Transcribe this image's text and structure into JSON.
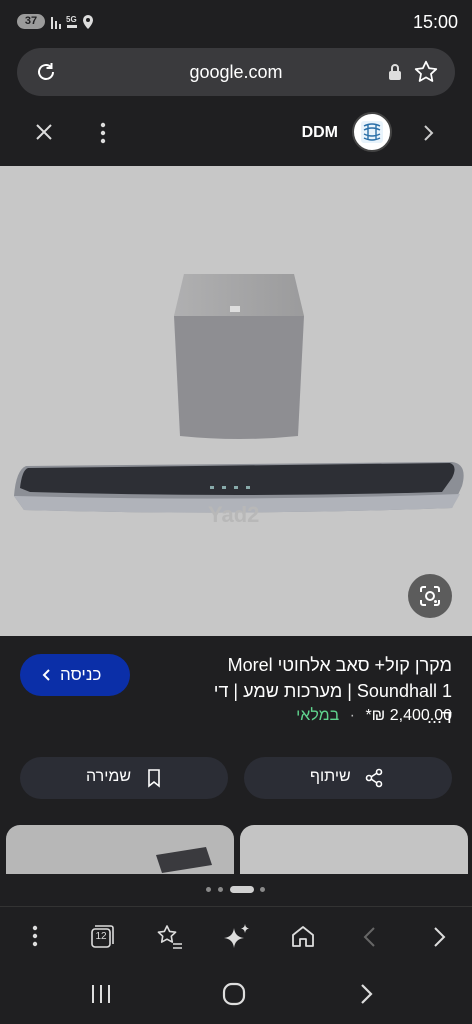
{
  "status_bar": {
    "battery": "37",
    "network": "5G",
    "time": "15:00"
  },
  "browser": {
    "url": "google.com"
  },
  "panel": {
    "site_name": "DDM"
  },
  "product": {
    "title": "מקרן קול+ סאב אלחוטי Morel Soundhall 1 | מערכות שמע | די ד...",
    "price": "2,400.00 ₪*",
    "separator": "·",
    "availability": "במלאי",
    "visit_label": "כניסה",
    "share_label": "שיתוף",
    "save_label": "שמירה",
    "watermark": "Yad2"
  },
  "toolbar": {
    "tabs_count": "12"
  }
}
